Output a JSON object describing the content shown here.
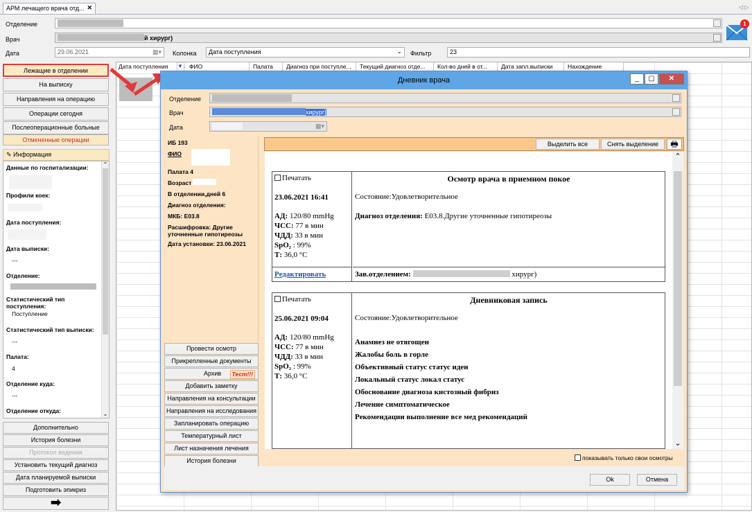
{
  "tab": {
    "title": "АРМ лечащего врача отд...",
    "close": "✕"
  },
  "form": {
    "dept_label": "Отделение",
    "doctor_label": "Врач",
    "doctor_value": "й хирург)",
    "date_label": "Дата",
    "date_value": "29.06.2021",
    "column_label": "Колонка",
    "column_value": "Дата поступления",
    "filter_label": "Фильтр",
    "filter_value": "23",
    "mail_badge": "1"
  },
  "left_nav": [
    "Лежащие в отделении",
    "На выписку",
    "Направления на операцию",
    "Операции сегодня",
    "Послеоперационные больные",
    "Отмененные операции"
  ],
  "info": {
    "header": "Информация",
    "items": [
      {
        "k": "Данные по госпитализации:",
        "v": ""
      },
      {
        "k": "Профили коек:",
        "v": ""
      },
      {
        "k": "Дата поступления:",
        "v": ""
      },
      {
        "k": "Дата выписки:",
        "v": "---"
      },
      {
        "k": "Отделение:",
        "v": ""
      },
      {
        "k": "Статистический тип поступления:",
        "v": "Поступление"
      },
      {
        "k": "Статистический тип выписки:",
        "v": "---"
      },
      {
        "k": "Палата:",
        "v": "4"
      },
      {
        "k": "Отделение куда:",
        "v": "---"
      },
      {
        "k": "Отделение откуда:",
        "v": ""
      }
    ]
  },
  "left_bottom": [
    "Дополнительно",
    "История болезни",
    "Протокол ведения",
    "Установить текущий диагноз",
    "Дата планируемой выписки",
    "Подготовить эпикриз"
  ],
  "grid_headers": [
    "Дата поступления",
    "ФИО",
    "Палата",
    "Диагноз при поступле...",
    "Текущий диагноз отде...",
    "Кол-во дней в от...",
    "Дата запл.выписки",
    "Нахождение"
  ],
  "dialog": {
    "title": "Дневник врача",
    "dept_label": "Отделение",
    "doctor_label": "Врач",
    "doctor_value": "хирург]",
    "date_label": "Дата",
    "patient": {
      "ib": "ИБ 193",
      "fio_label": "ФИО",
      "ward": "Палата 4",
      "age_label": "Возраст",
      "days": "В отделении,дней 6",
      "diag_label": "Диагноз отделения:",
      "mkb": "МКБ: E03.8",
      "decode": "Расшифровка: Другие уточненные гипотиреозы",
      "install": "Дата установки: 23.06.2021"
    },
    "side_buttons": [
      "Провести осмотр",
      "Прикрепленные документы",
      "Архив",
      "Добавить заметку",
      "Направления на консультации",
      "Направления на исследования",
      "Запланировать операцию",
      "Температурный лист",
      "Лист назначения лечения",
      "История болезни"
    ],
    "test_badge": "Тест!!!",
    "select_all": "Выделить все",
    "deselect": "Снять выделение",
    "records": [
      {
        "print": "Печатать",
        "datetime": "23.06.2021 16:41",
        "title": "Осмотр врача в приемном покое",
        "state": "Состояние:Удовлетворительное",
        "ad": "АД:",
        "ad_v": "120/80 mmHg",
        "hss": "ЧСС:",
        "hss_v": "77 в мин",
        "chdd": "ЧДД:",
        "chdd_v": "33 в мин",
        "spo": "SpO₂",
        "spo_v": ": 99%",
        "t": "Т:",
        "t_v": "36,0 °C",
        "diag_k": "Диагноз отделения:",
        "diag_v": "E03.8.Другие уточненные гипотиреозы",
        "edit": "Редактировать",
        "head_k": "Зав.отделением:",
        "head_v": "хирург)"
      },
      {
        "print": "Печатать",
        "datetime": "25.06.2021 09:04",
        "title": "Дневниковая запись",
        "state": "Состояние:Удовлетворительное",
        "ad": "АД:",
        "ad_v": "120/80 mmHg",
        "hss": "ЧСС:",
        "hss_v": "77 в мин",
        "chdd": "ЧДД:",
        "chdd_v": "33 в мин",
        "spo": "SpO₂",
        "spo_v": ": 99%",
        "t": "Т:",
        "t_v": "36,0 °C",
        "lines": [
          "Анамнез не отягощен",
          "Жалобы боль в горле",
          "Объективный статус статус иден",
          "Локальный статус локал статус",
          "Обоснование диагноза кистозный фибриз",
          "Лечение симптоматическое",
          "Рекомендации выполнение все мед рекомендаций"
        ]
      }
    ],
    "own_only": "показывать только свои осмотры",
    "ok": "Ok",
    "cancel": "Отмена"
  },
  "colors": {
    "accent": "#5fa6e6",
    "panel": "#fde4c5",
    "highlight": "#e03a3a",
    "selected": "#fbe9c4"
  }
}
